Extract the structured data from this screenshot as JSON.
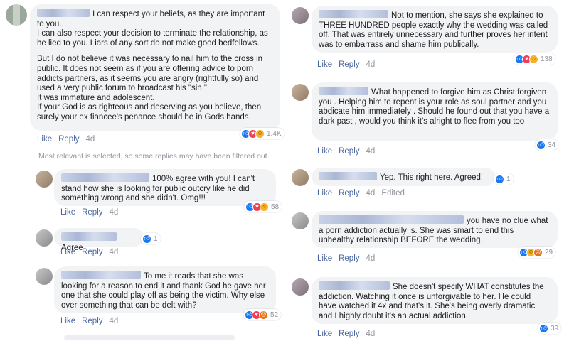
{
  "comments": [
    {
      "paragraphs": [
        "I can respect your beliefs, as they are important to you.\nI can also respect your decision to terminate the relationship, as he lied to you. Liars of any sort do not make good bedfellows.",
        "But I do not believe it was necessary to nail him to the cross in public. It does not seem as if you are offering advice to porn addicts partners, as it seems you are angry (rightfully so) and used a very public forum to broadcast his \"sin.\"\nIt was immature and adolescent.\nIf your God is as righteous and deserving as you believe, then surely your ex fiancee's penance should be in Gods hands."
      ],
      "actions": [
        "Like",
        "Reply",
        "4d"
      ],
      "reaction_icons": [
        "like",
        "love",
        "haha"
      ],
      "reaction_count": "1.4K"
    },
    {
      "paragraphs": [
        "100% agree with you! I can't stand how she is looking for public outcry like he did something wrong and she didn't. Omg!!!"
      ],
      "actions": [
        "Like",
        "Reply",
        "4d"
      ],
      "reaction_icons": [
        "like",
        "love",
        "wow"
      ],
      "reaction_count": "58"
    },
    {
      "paragraphs": [
        "Agree"
      ],
      "actions": [
        "Like",
        "Reply",
        "4d"
      ],
      "reaction_icons": [
        "like"
      ],
      "reaction_count": "1"
    },
    {
      "paragraphs": [
        "To me it reads that she was looking for a reason to end it and thank God he gave her one that she could play off as being the victim. Why else over something that can be delt with?"
      ],
      "actions": [
        "Like",
        "Reply",
        "4d"
      ],
      "reaction_icons": [
        "like",
        "love",
        "angry"
      ],
      "reaction_count": "52"
    },
    {
      "paragraphs": [
        "Not to mention, she says she explained to THREE HUNDRED people exactly why the wedding was called off. That was entirely unnecessary and further proves her intent was to embarrass and shame him publically."
      ],
      "actions": [
        "Like",
        "Reply",
        "4d"
      ],
      "reaction_icons": [
        "like",
        "love",
        "wow"
      ],
      "reaction_count": "138"
    },
    {
      "paragraphs": [
        "What happened to forgive him as Christ forgiven you . Helping him to repent is your role as soul partner and you abdicate him immediately . Should he found out that you have a dark past , would you think it's alright to flee from you too"
      ],
      "actions": [
        "Like",
        "Reply",
        "4d"
      ],
      "reaction_icons": [
        "like"
      ],
      "reaction_count": "34"
    },
    {
      "paragraphs": [
        "Yep. This right here. Agreed!"
      ],
      "actions": [
        "Like",
        "Reply",
        "4d",
        "Edited"
      ],
      "reaction_icons": [
        "like"
      ],
      "reaction_count": "1"
    },
    {
      "paragraphs": [
        "you have no clue what a porn addiction actually is. She was smart to end this unhealthy relationship BEFORE the wedding."
      ],
      "actions": [
        "Like",
        "Reply",
        "4d"
      ],
      "reaction_icons": [
        "like",
        "haha",
        "angry"
      ],
      "reaction_count": "29"
    },
    {
      "paragraphs": [
        "She doesn't specify WHAT constitutes the addiction. Watching it once is unforgivable to her. He could have watched it 4x and that's it. She's being overly dramatic and I highly doubt it's an actual addiction."
      ],
      "actions": [
        "Like",
        "Reply",
        "4d"
      ],
      "reaction_icons": [
        "like"
      ],
      "reaction_count": "39"
    }
  ],
  "filter_notice": "Most relevant is selected, so some replies may have been filtered out.",
  "colors": {
    "link": "#4b67a1",
    "muted": "#90949c",
    "bubble": "#f2f3f5",
    "like": "#1877f2"
  }
}
